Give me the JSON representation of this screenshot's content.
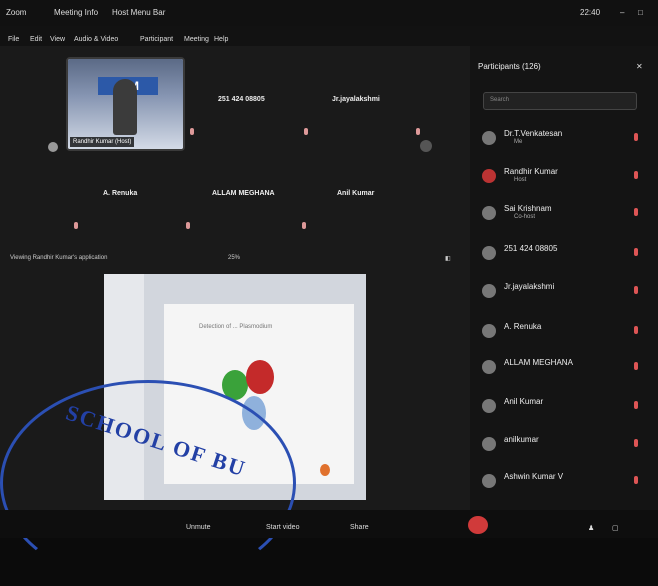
{
  "window": {
    "app_title": "Zoom",
    "meeting_info": "Meeting Info",
    "host_menu": "Host Menu Bar",
    "clock": "22:40"
  },
  "menu": [
    "File",
    "Edit",
    "View",
    "Audio & Video",
    "Participant",
    "Meeting",
    "Help"
  ],
  "gallery": {
    "host_tile_label": "Randhir Kumar (Host)",
    "host_banner": "NIM",
    "tiles": [
      "251 424 08805",
      "Jr.jayalakshmi",
      "A. Renuka",
      "ALLAM MEGHANA",
      "Anil Kumar"
    ]
  },
  "viewing": {
    "label": "Viewing Randhir Kumar's application",
    "zoom": "25%"
  },
  "shared_slide": {
    "title": "Detection of ... Plasmodium"
  },
  "stamp": {
    "text": "SCHOOL OF BU"
  },
  "toolbar": {
    "unmute": "Unmute",
    "start_video": "Start video",
    "share": "Share"
  },
  "participants": {
    "header": "Participants (126)",
    "search_placeholder": "Search",
    "list": [
      {
        "name": "Dr.T.Venkatesan",
        "role": "Me"
      },
      {
        "name": "Randhir Kumar",
        "role": "Host"
      },
      {
        "name": "Sai Krishnam",
        "role": "Co-host"
      },
      {
        "name": "251 424 08805",
        "role": ""
      },
      {
        "name": "Jr.jayalakshmi",
        "role": ""
      },
      {
        "name": "A. Renuka",
        "role": ""
      },
      {
        "name": "ALLAM MEGHANA",
        "role": ""
      },
      {
        "name": "Anil Kumar",
        "role": ""
      },
      {
        "name": "anilkumar",
        "role": ""
      },
      {
        "name": "Ashwin Kumar V",
        "role": ""
      }
    ]
  },
  "colors": {
    "background": "#0b0b0b",
    "stamp": "#2b4fb3",
    "leave_button": "#d03a3a",
    "mic_muted": "#d55555"
  }
}
